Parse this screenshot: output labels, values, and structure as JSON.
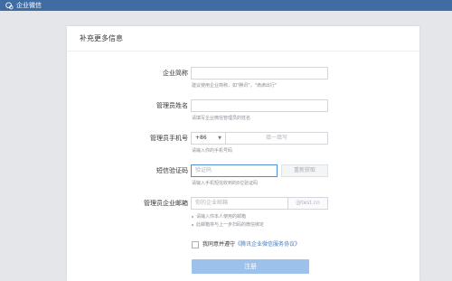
{
  "brand": {
    "name": "企业微信",
    "icon": "wecom-logo-icon"
  },
  "page": {
    "title": "补充更多信息"
  },
  "form": {
    "company_name": {
      "label": "企业简称",
      "value": "",
      "hint": "建议使用企业简称，如\"腾讯\"，\"滴滴出行\""
    },
    "admin_name": {
      "label": "管理员姓名",
      "value": "",
      "hint": "请填写企业微信管理员的姓名"
    },
    "phone": {
      "label": "管理员手机号",
      "country_code": "+86",
      "placeholder": "填一填写",
      "hint": "请输入你的手机号码"
    },
    "sms_code": {
      "label": "短信验证码",
      "placeholder": "验证码",
      "button": "重新获取",
      "hint": "请输入手机短信收到的6位验证码"
    },
    "email": {
      "label": "管理员企业邮箱",
      "placeholder": "你的企业邮箱",
      "suffix": "@test.cn",
      "hints": [
        "请输入你本人使用的邮箱",
        "此邮箱将与上一步扫码的微信绑定"
      ]
    },
    "agreement": {
      "prefix": "我同意并遵守",
      "link": "《腾讯企业微信服务协议》",
      "checked": false
    },
    "submit": {
      "label": "注册"
    }
  },
  "colors": {
    "topbar": "#3f6da3",
    "link": "#3f7cc4",
    "button": "#9cc1ea",
    "focus_border": "#4c8ed9"
  }
}
